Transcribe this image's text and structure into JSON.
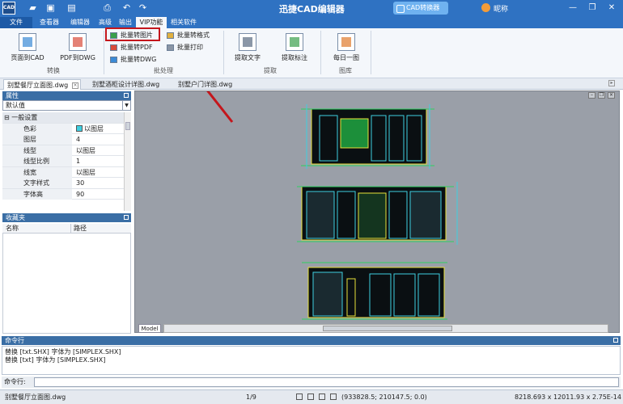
{
  "window": {
    "title": "迅捷CAD编辑器",
    "logo": "CAD",
    "converter_button": "CAD转换器",
    "user_name": "昵称",
    "controls": [
      "minimize-icon",
      "restore-icon",
      "close-icon"
    ],
    "quick_access": [
      "open-folder-icon",
      "save-icon",
      "save-as-icon",
      "print-icon",
      "undo-icon",
      "redo-icon"
    ]
  },
  "ribbon_tabs": [
    "文件",
    "查看器",
    "编辑器",
    "高级",
    "输出",
    "VIP功能",
    "相关软件"
  ],
  "ribbon": {
    "convert": {
      "label": "转换",
      "buttons": [
        "页面到CAD",
        "PDF到DWG"
      ]
    },
    "batch": {
      "label": "批处理",
      "buttons": [
        "批量转图片",
        "批量转PDF",
        "批量转DWG",
        "批量转格式",
        "批量打印"
      ]
    },
    "extract": {
      "label": "提取",
      "buttons": [
        "提取文字",
        "提取标注"
      ]
    },
    "gallery": {
      "label": "图库",
      "buttons": [
        "每日一图"
      ]
    }
  },
  "doc_tabs": [
    "别墅餐厅立面图.dwg",
    "别墅酒柜设计详图.dwg",
    "别墅户门详图.dwg"
  ],
  "properties": {
    "title": "属性",
    "selector": "默认值",
    "group": "一般设置",
    "rows": [
      {
        "key": "色彩",
        "value": "以图层"
      },
      {
        "key": "图层",
        "value": "4"
      },
      {
        "key": "线型",
        "value": "以图层"
      },
      {
        "key": "线型比例",
        "value": "1"
      },
      {
        "key": "线宽",
        "value": "以图层"
      },
      {
        "key": "文字样式",
        "value": "30"
      },
      {
        "key": "字体高",
        "value": "90"
      }
    ],
    "color_swatch": "#3ecfe0"
  },
  "favorites": {
    "title": "收藏夹",
    "columns": [
      "名称",
      "路径"
    ]
  },
  "canvas": {
    "model_tab": "Model",
    "background": "#9a9fa8"
  },
  "command": {
    "title": "命令行",
    "log": [
      "替换 [txt.SHX] 字体为 [SIMPLEX.SHX]",
      "替换 [txt] 字体为 [SIMPLEX.SHX]"
    ],
    "prompt": "命令行:"
  },
  "status": {
    "file": "别墅餐厅立面图.dwg",
    "page": "1/9",
    "coords": "(933828.5; 210147.5; 0.0)",
    "dimensions": "8218.693 x 12011.93 x 2.75E-14"
  }
}
